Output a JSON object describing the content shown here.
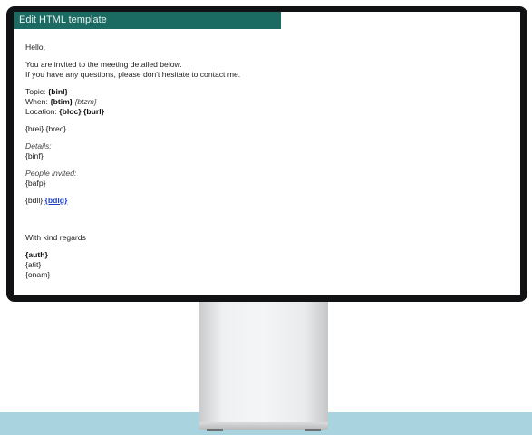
{
  "window": {
    "title": "Edit HTML template"
  },
  "template": {
    "greeting": "Hello,",
    "intro_1": "You are invited to the meeting detailed below.",
    "intro_2": "If you have any questions, please don't hesitate to contact me.",
    "topic_label": "Topic:",
    "topic_value": "{binl}",
    "when_label": "When:",
    "when_value": "{btim}",
    "when_tz": "{btzm}",
    "location_label": "Location:",
    "location_value": "{bloc}",
    "location_url": "{burl}",
    "brei": "{brei}",
    "brec": "{brec}",
    "details_label": "Details:",
    "details_value": "{binf}",
    "people_label": "People invited:",
    "people_value": "{bafp}",
    "bdll": "{bdll}",
    "bdlg": "{bdlg}",
    "regards": "With kind regards",
    "auth": "{auth}",
    "atit": "{atit}",
    "onam": "{onam}"
  },
  "colors": {
    "title_bar": "#1b6b63",
    "link": "#1c3fc8",
    "backdrop": "#a9d4df"
  }
}
